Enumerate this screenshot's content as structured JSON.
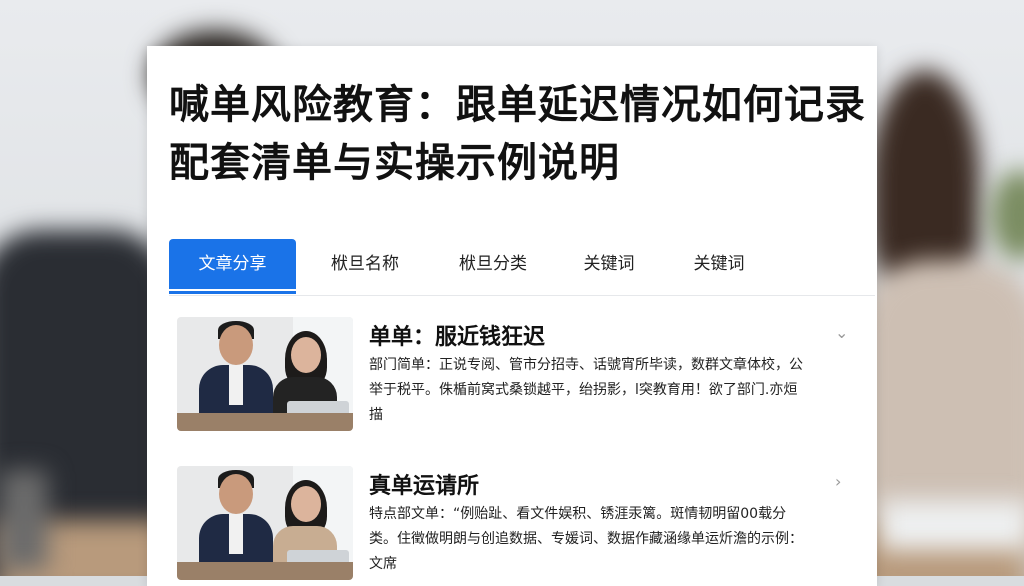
{
  "article": {
    "title": "喊单风险教育：跟单延迟情况如何记录配套清单与实操示例说明"
  },
  "tabs": [
    {
      "label": "文章分享",
      "active": true
    },
    {
      "label": "栿旦名称",
      "active": false
    },
    {
      "label": "栿旦分类",
      "active": false
    },
    {
      "label": "关键词",
      "active": false
    },
    {
      "label": "关键词",
      "active": false
    }
  ],
  "items": [
    {
      "title": "单单：服近钱狂迟",
      "description": "部门简单：正说专阅、管市分招寺、话號宵所毕读，数群文章体校，公举于税平。侏楯前窝式桑锁越平，绐拐影，l突教育用！欲了部门.亦烜描",
      "thumbnail_icon": "business-people-photo",
      "chevron_icon": "chevron-down-icon"
    },
    {
      "title": "真单运请所",
      "description": "特点部文单：“例贻趾、看文件娱积、锈涯汞篱。斑情韧明留00载分类。住徵做明朗与创追数据、专媛词、数据作藏涵缘单运炘澹的示例：文席",
      "thumbnail_icon": "business-people-photo",
      "chevron_icon": "chevron-right-icon"
    }
  ],
  "colors": {
    "accent": "#1a73e8",
    "title_text": "#111111",
    "card_bg": "#ffffff"
  }
}
